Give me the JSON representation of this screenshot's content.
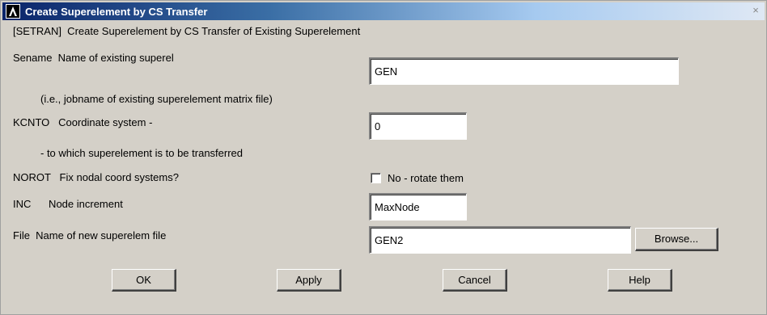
{
  "window": {
    "title": "Create Superelement by CS Transfer",
    "close_symbol": "×"
  },
  "header": {
    "text": "[SETRAN]  Create Superelement by CS Transfer of Existing Superelement"
  },
  "fields": {
    "sename": {
      "label": "Sename  Name of existing superel",
      "value": "GEN",
      "note": "(i.e., jobname of existing superelement matrix file)"
    },
    "kcnto": {
      "label": "KCNTO   Coordinate system -",
      "value": "0",
      "note": "- to which superelement is to be transferred"
    },
    "norot": {
      "label": "NOROT   Fix nodal coord systems?",
      "checkbox_label": "No - rotate them",
      "checked": false
    },
    "inc": {
      "label": "INC      Node increment",
      "value": "MaxNode"
    },
    "file": {
      "label": "File  Name of new superelem file",
      "value": "GEN2",
      "browse_label": "Browse..."
    }
  },
  "buttons": {
    "ok": "OK",
    "apply": "Apply",
    "cancel": "Cancel",
    "help": "Help"
  },
  "icons": {
    "app": "ansys-logo-icon",
    "close": "close-icon"
  }
}
